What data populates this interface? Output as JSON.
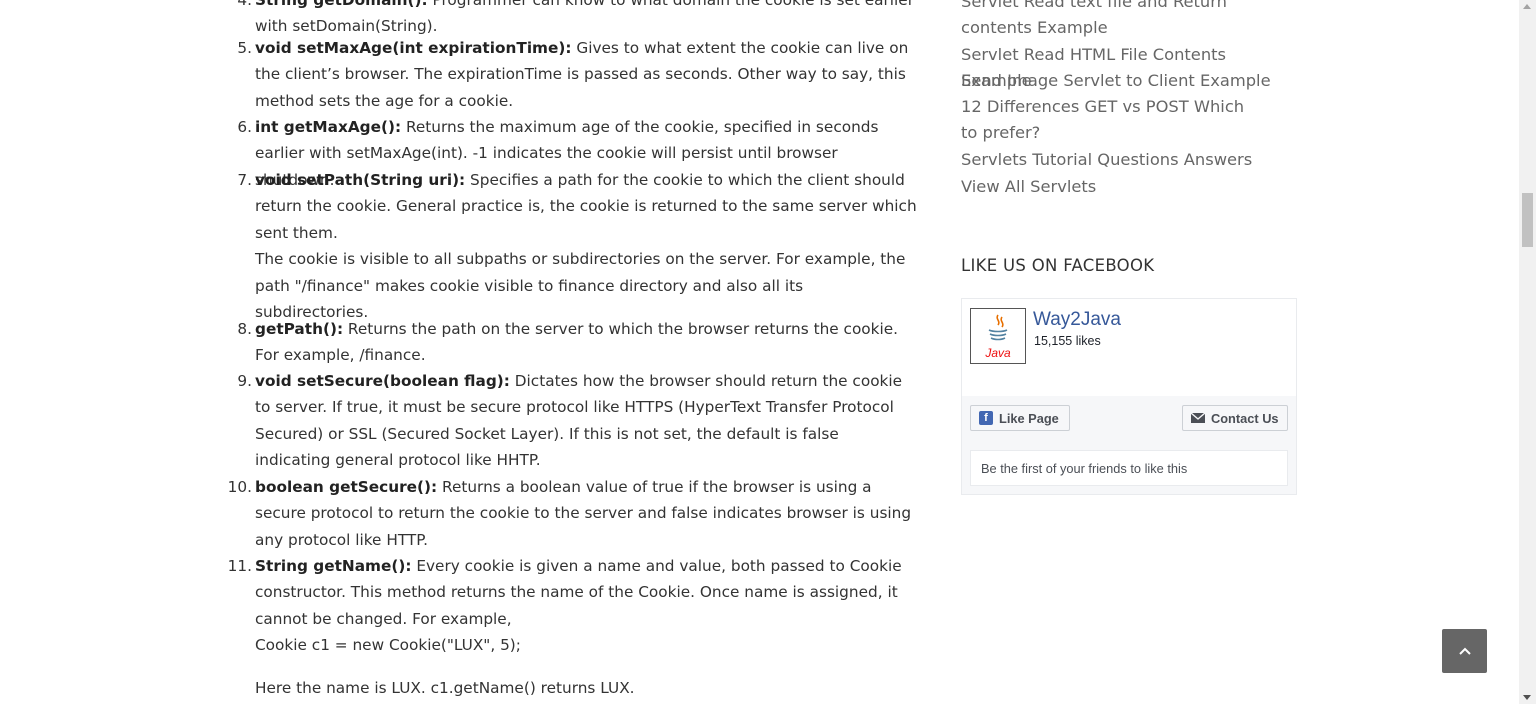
{
  "article": {
    "items": [
      {
        "num": "4.",
        "lines": [
          {
            "bold": "String getDomain():",
            "text": " Programmer can know to what domain the cookie is set earlier with setDomain(String)."
          }
        ]
      },
      {
        "num": "5.",
        "lines": [
          {
            "bold": "void setMaxAge(int expirationTime):",
            "text": " Gives to what extent the cookie can live on the client’s browser. The expirationTime is passed as seconds. Other way to say, this method sets the age for a cookie."
          }
        ]
      },
      {
        "num": "6.",
        "lines": [
          {
            "bold": "int getMaxAge():",
            "text": " Returns the maximum age of the cookie, specified in seconds earlier with setMaxAge(int). -1 indicates the cookie will persist until browser shutdown."
          }
        ]
      },
      {
        "num": "7.",
        "lines": [
          {
            "bold": "void setPath(String uri):",
            "text": " Specifies a path for the cookie to which the client should return the cookie. General practice is, the cookie is returned to the same server which sent them."
          }
        ],
        "extra": "The cookie is visible to all subpaths or subdirectories on the server. For example, the path \"/finance\" makes cookie visible to finance directory and also all its subdirectories."
      },
      {
        "num": "8.",
        "lines": [
          {
            "bold": "getPath():",
            "text": " Returns the path on the server to which the browser returns the cookie. For example, /finance."
          }
        ]
      },
      {
        "num": "9.",
        "lines": [
          {
            "bold": "void setSecure(boolean flag):",
            "text": " Dictates how the browser should return the cookie to server. If true, it must be secure protocol like HTTPS (HyperText Transfer Protocol Secured) or SSL (Secured Socket Layer). If this is not set, the default is false indicating general protocol like HHTP."
          }
        ]
      },
      {
        "num": "10.",
        "lines": [
          {
            "bold": "boolean getSecure():",
            "text": " Returns a boolean value of true if the browser is using a secure protocol to return the cookie to the server and false indicates browser is using any protocol like HTTP."
          }
        ]
      },
      {
        "num": "11.",
        "lines": [
          {
            "bold": "String getName():",
            "text": " Every cookie is given a name and value, both passed to Cookie constructor. This method returns the name of the Cookie. Once name is assigned, it cannot be changed. For example,"
          }
        ],
        "extra": "Cookie c1 = new Cookie(\"LUX\", 5);",
        "extra2": "Here the name is LUX. c1.getName() returns LUX."
      }
    ]
  },
  "sidebar": {
    "links": [
      "Servlet Read text file and Return contents Example",
      "Servlet Read HTML File Contents Example",
      "Send Image Servlet to Client Example",
      "12 Differences GET vs POST Which to prefer?",
      "Servlets Tutorial Questions Answers",
      "View All Servlets"
    ],
    "facebook_title": "LIKE US ON FACEBOOK",
    "fb": {
      "page_name": "Way2Java",
      "likes": "15,155 likes",
      "logo_text": "Java",
      "like_button": "Like Page",
      "contact_button": "Contact Us",
      "friends_text": "Be the first of your friends to like this"
    }
  },
  "colors": {
    "fb_link": "#365899",
    "scroll_top_bg": "#666666"
  }
}
